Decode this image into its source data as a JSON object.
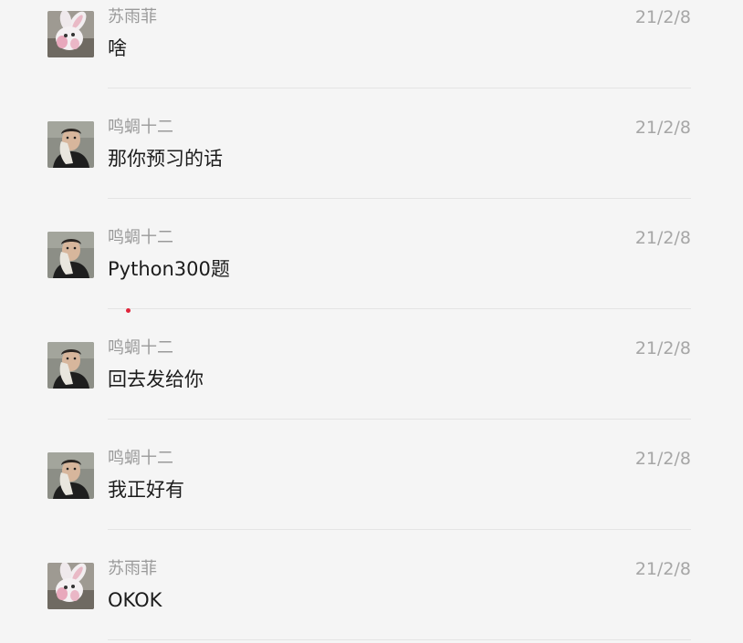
{
  "colors": {
    "background": "#f5f5f5",
    "sender": "#9a9a9a",
    "time": "#a6a6a6",
    "text": "#1c1c1c",
    "divider": "#e4e4e4",
    "indicator": "#e0243a"
  },
  "messages": [
    {
      "sender": "苏雨菲",
      "time": "21/2/8",
      "text": "啥",
      "avatar": "bunny-avatar-icon"
    },
    {
      "sender": "鸣蜩十二",
      "time": "21/2/8",
      "text": "那你预习的话",
      "avatar": "person-avatar-icon"
    },
    {
      "sender": "鸣蜩十二",
      "time": "21/2/8",
      "text": "Python300题",
      "avatar": "person-avatar-icon"
    },
    {
      "sender": "鸣蜩十二",
      "time": "21/2/8",
      "text": "回去发给你",
      "avatar": "person-avatar-icon"
    },
    {
      "sender": "鸣蜩十二",
      "time": "21/2/8",
      "text": "我正好有",
      "avatar": "person-avatar-icon"
    },
    {
      "sender": "苏雨菲",
      "time": "21/2/8",
      "text": "OKOK",
      "avatar": "bunny-avatar-icon"
    }
  ]
}
